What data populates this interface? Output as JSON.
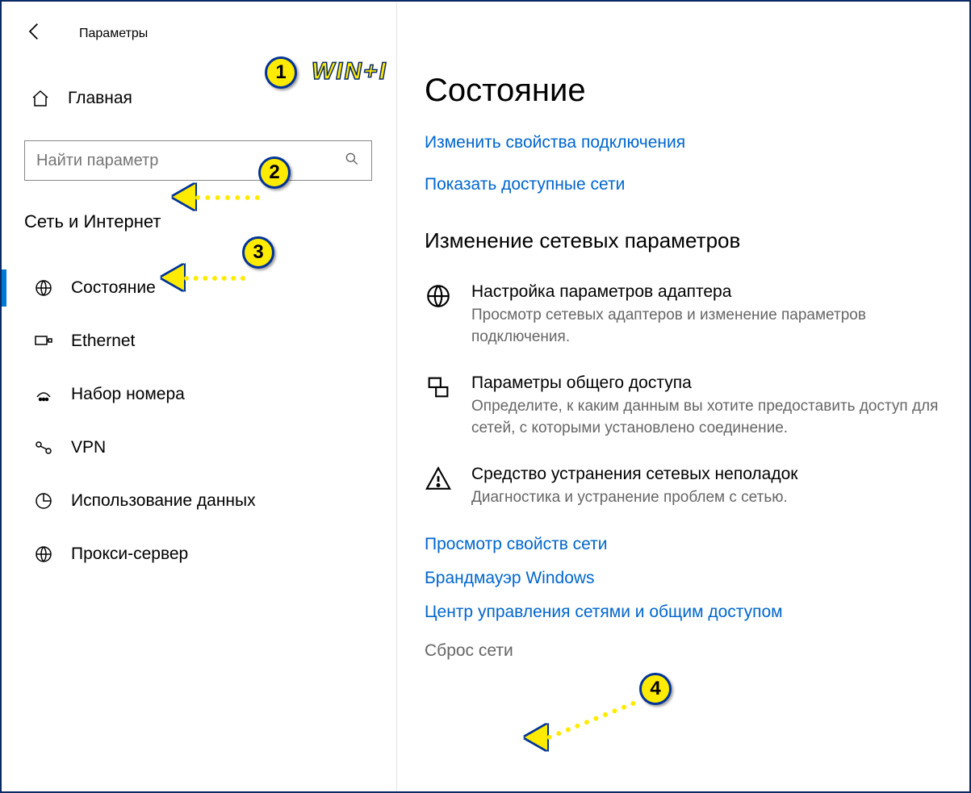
{
  "app": {
    "title": "Параметры"
  },
  "home": {
    "label": "Главная"
  },
  "search": {
    "placeholder": "Найти параметр"
  },
  "section": {
    "label": "Сеть и Интернет"
  },
  "nav": {
    "items": [
      {
        "label": "Состояние",
        "icon": "globe"
      },
      {
        "label": "Ethernet",
        "icon": "ethernet"
      },
      {
        "label": "Набор номера",
        "icon": "dialup"
      },
      {
        "label": "VPN",
        "icon": "vpn"
      },
      {
        "label": "Использование данных",
        "icon": "data"
      },
      {
        "label": "Прокси-сервер",
        "icon": "proxy"
      }
    ]
  },
  "main": {
    "title": "Состояние",
    "link_change_props": "Изменить свойства подключения",
    "link_available": "Показать доступные сети",
    "change_heading": "Изменение сетевых параметров",
    "options": [
      {
        "title": "Настройка параметров адаптера",
        "desc": "Просмотр сетевых адаптеров и изменение параметров подключения."
      },
      {
        "title": "Параметры общего доступа",
        "desc": "Определите, к каким данным вы хотите предоставить доступ для сетей, с которыми установлено соединение."
      },
      {
        "title": "Средство устранения сетевых неполадок",
        "desc": "Диагностика и устранение проблем с сетью."
      }
    ],
    "link_props": "Просмотр свойств сети",
    "link_firewall": "Брандмауэр Windows",
    "link_sharing_center": "Центр управления сетями и общим доступом",
    "link_reset": "Сброс сети"
  },
  "annotations": {
    "n1": "1",
    "n2": "2",
    "n3": "3",
    "n4": "4",
    "hotkey": "WIN+I"
  }
}
